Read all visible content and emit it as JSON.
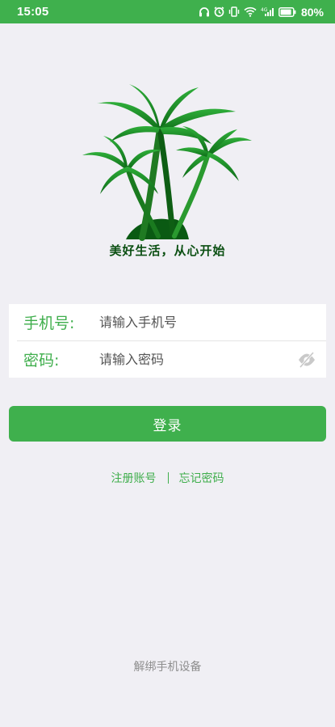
{
  "status_bar": {
    "time": "15:05",
    "battery_percent": "80%",
    "icons": [
      "headphones-icon",
      "alarm-icon",
      "vibrate-icon",
      "wifi-icon",
      "signal-icon",
      "battery-icon"
    ]
  },
  "brand": {
    "slogan": "美好生活，从心开始",
    "logo": "palm-tree-logo"
  },
  "login_form": {
    "phone_label": "手机号:",
    "phone_placeholder": "请输入手机号",
    "phone_value": "",
    "password_label": "密码:",
    "password_placeholder": "请输入密码",
    "password_value": "",
    "visibility_icon": "eye-off-icon"
  },
  "actions": {
    "login_label": "登录",
    "register_label": "注册账号",
    "forgot_label": "忘记密码",
    "unbind_label": "解绑手机设备"
  },
  "colors": {
    "primary": "#3fb04d",
    "background": "#f0eff4",
    "slogan": "#0b4f12",
    "muted": "#8e8e8e"
  }
}
